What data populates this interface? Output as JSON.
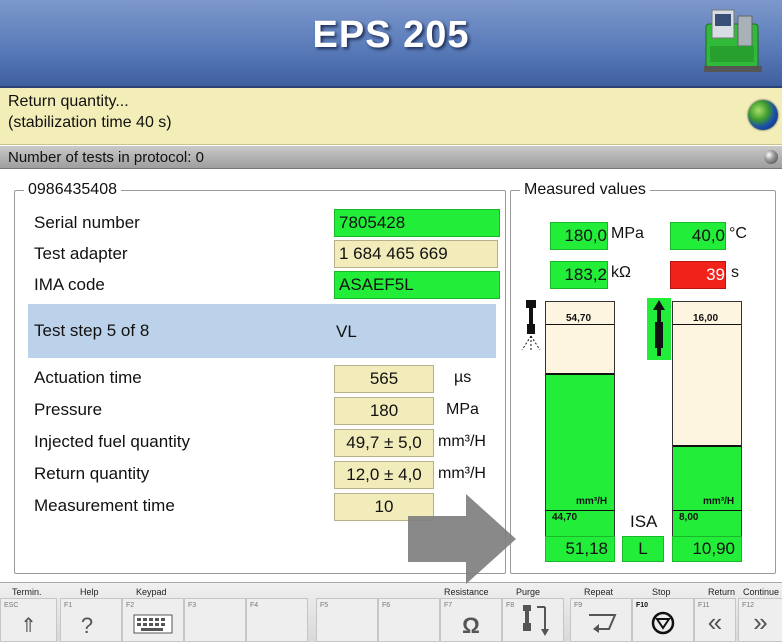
{
  "header": {
    "title": "EPS 205"
  },
  "message": {
    "line1": "Return quantity...",
    "line2": "(stabilization time 40 s)"
  },
  "protocol": {
    "text": "Number of tests in protocol: 0"
  },
  "test": {
    "part_number": "0986435408",
    "fields": [
      {
        "label": "Serial number",
        "value": "7805428",
        "state": "ok"
      },
      {
        "label": "Test adapter",
        "value": "1 684 465 669",
        "state": "normal"
      },
      {
        "label": "IMA code",
        "value": "ASAEF5L",
        "state": "ok"
      }
    ],
    "step": {
      "label": "Test step 5 of 8",
      "value": "VL"
    },
    "params": [
      {
        "label": "Actuation time",
        "value": "565",
        "unit": "µs"
      },
      {
        "label": "Pressure",
        "value": "180",
        "unit": "MPa"
      },
      {
        "label": "Injected fuel quantity",
        "value": "49,7 ± 5,0",
        "unit": "mm³/H"
      },
      {
        "label": "Return quantity",
        "value": "12,0 ± 4,0",
        "unit": "mm³/H"
      },
      {
        "label": "Measurement time",
        "value": "10",
        "unit": ""
      }
    ]
  },
  "measured": {
    "title": "Measured values",
    "pressure": {
      "value": "180,0",
      "unit": "MPa"
    },
    "temperature": {
      "value": "40,0",
      "unit": "°C"
    },
    "resistance": {
      "value": "183,2",
      "unit": "kΩ"
    },
    "time": {
      "value": "39",
      "unit": "s"
    },
    "gauge_left": {
      "top_label": "54,70",
      "bottom_label": "44,70",
      "unit": "mm³/H",
      "reading": "51,18",
      "level_fraction": 0.69
    },
    "gauge_right": {
      "top_label": "16,00",
      "bottom_label": "8,00",
      "unit": "mm³/H",
      "reading": "10,90",
      "level_fraction": 0.38
    },
    "isa": {
      "label": "ISA",
      "value": "L"
    }
  },
  "fkeys": {
    "top_labels": {
      "esc": "Termin.",
      "f1": "Help",
      "f2": "Keypad",
      "f7": "Resistance",
      "f8": "Purge",
      "f9": "Repeat",
      "f10": "Stop",
      "f11": "Return",
      "f12": "Continue"
    },
    "codes": [
      "ESC",
      "F1",
      "F2",
      "F3",
      "F4",
      "F5",
      "F6",
      "F7",
      "F8",
      "F9",
      "F10",
      "F11",
      "F12"
    ],
    "icons": {
      "esc": "double-up-arrow-icon",
      "f1": "question-icon",
      "f2": "keyboard-icon",
      "f7": "ohm-icon",
      "f8": "purge-injector-icon",
      "f9": "repeat-icon",
      "f10": "stop-icon",
      "f11": "return-icon",
      "f12": "continue-icon"
    }
  },
  "colors": {
    "header_blue": "#5a7cba",
    "ok_green": "#22ee3a",
    "alert_red": "#f0221a",
    "message_yellow": "#f3eeb8",
    "step_blue": "#bcd2ea"
  }
}
